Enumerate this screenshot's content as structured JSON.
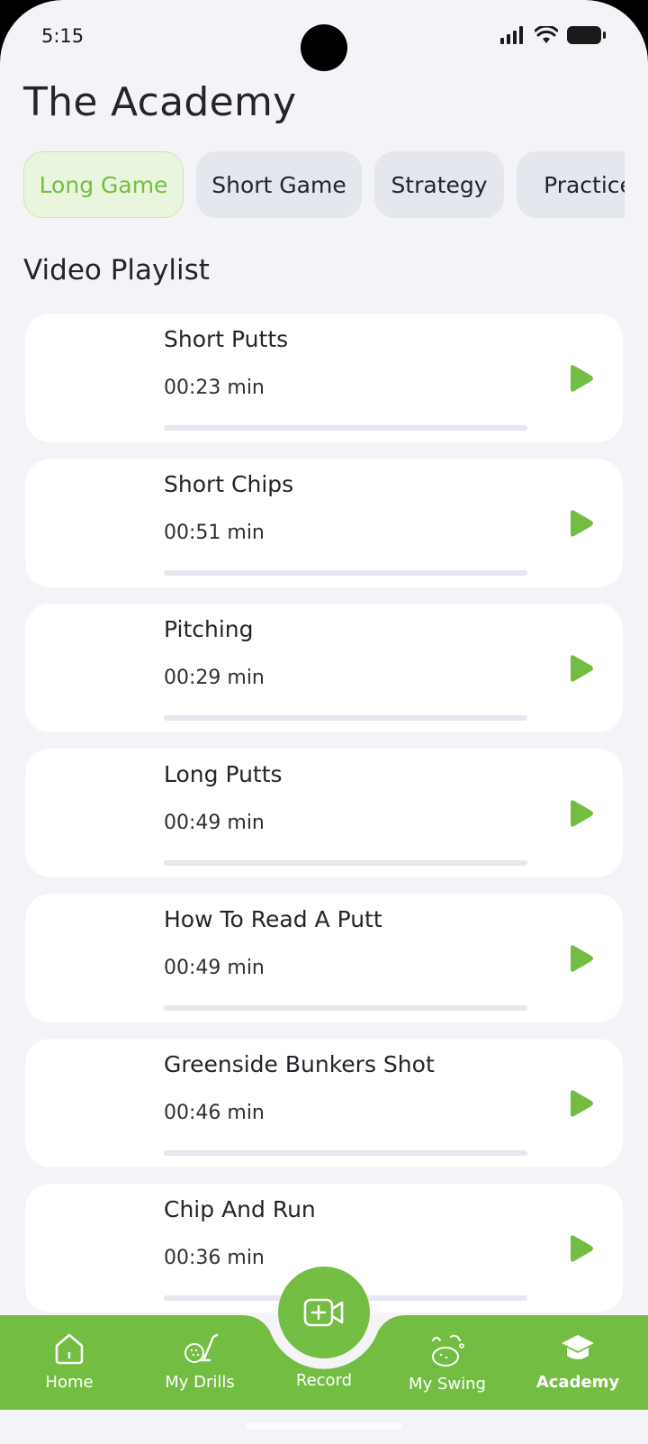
{
  "status_bar": {
    "time": "5:15"
  },
  "header": {
    "title": "The Academy"
  },
  "tabs": [
    {
      "label": "Long Game",
      "active": true
    },
    {
      "label": "Short Game",
      "active": false
    },
    {
      "label": "Strategy",
      "active": false
    },
    {
      "label": "Practice",
      "active": false
    }
  ],
  "playlist": {
    "title": "Video Playlist",
    "items": [
      {
        "title": "Short Putts",
        "duration": "00:23 min",
        "progress": 0
      },
      {
        "title": "Short Chips",
        "duration": "00:51 min",
        "progress": 0
      },
      {
        "title": "Pitching",
        "duration": "00:29 min",
        "progress": 0
      },
      {
        "title": "Long Putts",
        "duration": "00:49 min",
        "progress": 0
      },
      {
        "title": "How To Read A Putt",
        "duration": "00:49 min",
        "progress": 0
      },
      {
        "title": "Greenside Bunkers Shot",
        "duration": "00:46 min",
        "progress": 0
      },
      {
        "title": "Chip And Run",
        "duration": "00:36 min",
        "progress": 0
      }
    ]
  },
  "bottom_nav": {
    "items": [
      {
        "label": "Home",
        "icon": "home-icon",
        "active": false
      },
      {
        "label": "My Drills",
        "icon": "golf-drills-icon",
        "active": false
      },
      {
        "label": "My Swing",
        "icon": "golf-ball-swing-icon",
        "active": false
      },
      {
        "label": "Academy",
        "icon": "graduation-cap-icon",
        "active": true
      }
    ],
    "record": {
      "label": "Record",
      "icon": "video-add-icon"
    }
  },
  "colors": {
    "accent": "#74bd43",
    "background": "#f3f3f8",
    "card": "#ffffff",
    "tab_inactive": "#e5e7ee"
  }
}
